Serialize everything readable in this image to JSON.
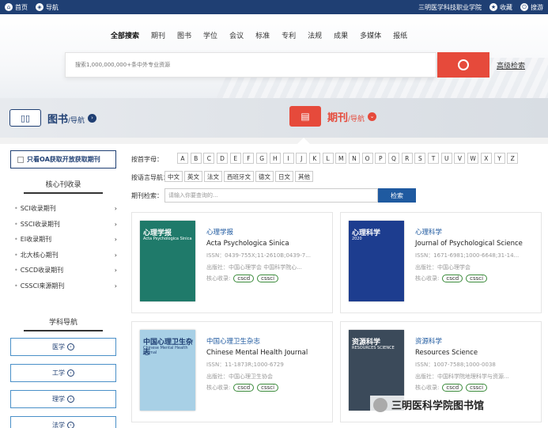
{
  "topbar": {
    "home": "首页",
    "nav": "导航",
    "school": "三明医学科技职业学院",
    "favorite": "收藏",
    "search": "搜游"
  },
  "hero": {
    "categories": [
      "全部搜索",
      "期刊",
      "图书",
      "学位",
      "会议",
      "标准",
      "专利",
      "法规",
      "成果",
      "多媒体",
      "报纸"
    ],
    "search_placeholder": "搜索1,000,000,000+条中外专业资源",
    "advanced": "高级检索"
  },
  "navstrip": {
    "book_title": "图书",
    "book_sub": "/导航",
    "journal_title": "期刊",
    "journal_sub": "/导航"
  },
  "sidebar": {
    "oa_label": "只看OA获取开放获取期刊",
    "core_title": "核心刊收录",
    "core_items": [
      "SCI收录期刊",
      "SSCI收录期刊",
      "EI收录期刊",
      "北大核心期刊",
      "CSCD收录期刊",
      "CSSCI来源期刊"
    ],
    "subject_title": "学科导航",
    "subjects": [
      "医学",
      "工学",
      "理学",
      "法学"
    ]
  },
  "filters": {
    "letter_label": "按首字母：",
    "letters": [
      "A",
      "B",
      "C",
      "D",
      "E",
      "F",
      "G",
      "H",
      "I",
      "J",
      "K",
      "L",
      "M",
      "N",
      "O",
      "P",
      "Q",
      "R",
      "S",
      "T",
      "U",
      "V",
      "W",
      "X",
      "Y",
      "Z"
    ],
    "lang_label": "按语言导航：",
    "langs": [
      "中文",
      "英文",
      "法文",
      "西班牙文",
      "德文",
      "日文",
      "其他"
    ],
    "search_label": "期刊检索：",
    "search_placeholder": "请输入你要查询的...",
    "search_button": "检索"
  },
  "journals": [
    {
      "cn": "心理学报",
      "en": "Acta Psychologica Sinica",
      "issn": "ISSN：0439-755X;11-2610B;0439-7...",
      "publisher": "出版社：中国心理学会 中国科学院心...",
      "tags_label": "核心收录:",
      "tags": [
        "cscd",
        "cssci"
      ],
      "cover_title": "心理学报",
      "cover_sub": "Acta Psychologica Sinica",
      "cover_color": "#1f7a6a"
    },
    {
      "cn": "心理科学",
      "en": "Journal of Psychological Science",
      "issn": "ISSN：1671-6981;1000-6648;31-14...",
      "publisher": "出版社：中国心理学会",
      "tags_label": "核心收录:",
      "tags": [
        "cscd",
        "cssci"
      ],
      "cover_title": "心理科学",
      "cover_sub": "2020",
      "cover_color": "#1d3d8f"
    },
    {
      "cn": "中国心理卫生杂志",
      "en": "Chinese Mental Health Journal",
      "issn": "ISSN：11-1873R;1000-6729",
      "publisher": "出版社：中国心理卫生协会",
      "tags_label": "核心收录:",
      "tags": [
        "cscd",
        "cssci"
      ],
      "cover_title": "中国心理卫生杂志",
      "cover_sub": "Chinese Mental Health Journal",
      "cover_color": "#a8d0e6"
    },
    {
      "cn": "资源科学",
      "en": "Resources Science",
      "issn": "ISSN：1007-7588;1000-0038",
      "publisher": "出版社：中国科学院地理科学与资源...",
      "tags_label": "核心收录:",
      "tags": [
        "cscd",
        "cssci"
      ],
      "cover_title": "资源科学",
      "cover_sub": "RESOURCES SCIENCE",
      "cover_color": "#3b4a5a"
    }
  ],
  "watermark": "三明医科学院图书馆"
}
